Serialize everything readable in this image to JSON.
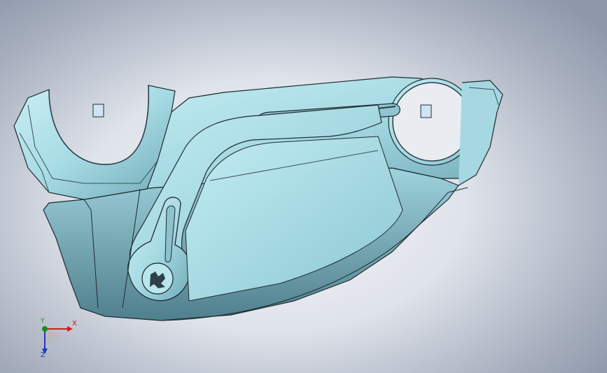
{
  "viewport": {
    "background_colors": {
      "center": "#f4f5f8",
      "edge": "#8f98aa"
    },
    "part_color": "#9fd6e0"
  },
  "triad": {
    "x_label": "X",
    "y_label": "Y",
    "z_label": "Z",
    "colors": {
      "x": "#d11c1c",
      "y": "#1a8a1a",
      "z": "#1f3bb0"
    }
  }
}
